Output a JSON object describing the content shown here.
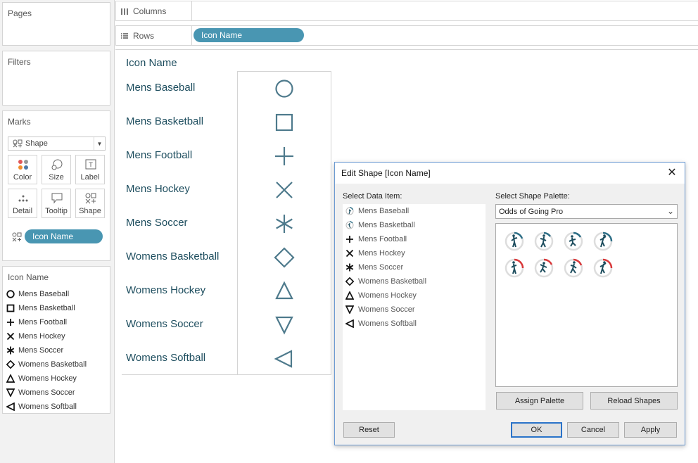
{
  "left": {
    "pages_title": "Pages",
    "filters_title": "Filters",
    "marks_title": "Marks",
    "mark_type": "Shape",
    "mark_buttons": {
      "color": "Color",
      "size": "Size",
      "label": "Label",
      "detail": "Detail",
      "tooltip": "Tooltip",
      "shape": "Shape"
    },
    "shape_pill": "Icon Name",
    "legend": {
      "title": "Icon Name",
      "items": [
        "Mens Baseball",
        "Mens Basketball",
        "Mens Football",
        "Mens Hockey",
        "Mens Soccer",
        "Womens Basketball",
        "Womens Hockey",
        "Womens Soccer",
        "Womens Softball"
      ]
    }
  },
  "shelves": {
    "columns_label": "Columns",
    "rows_label": "Rows",
    "rows_pill": "Icon Name"
  },
  "view": {
    "header": "Icon Name",
    "rows": [
      {
        "label": "Mens Baseball",
        "shape": "circle-icon"
      },
      {
        "label": "Mens Basketball",
        "shape": "square-icon"
      },
      {
        "label": "Mens Football",
        "shape": "plus-icon"
      },
      {
        "label": "Mens Hockey",
        "shape": "x-icon"
      },
      {
        "label": "Mens Soccer",
        "shape": "asterisk-icon"
      },
      {
        "label": "Womens Basketball",
        "shape": "diamond-icon"
      },
      {
        "label": "Womens Hockey",
        "shape": "triangle-up-icon"
      },
      {
        "label": "Womens Soccer",
        "shape": "triangle-down-icon"
      },
      {
        "label": "Womens Softball",
        "shape": "triangle-left-icon"
      }
    ],
    "shape_color": "#4e7a8c"
  },
  "dialog": {
    "title": "Edit Shape [Icon Name]",
    "select_item_label": "Select Data Item:",
    "select_palette_label": "Select Shape Palette:",
    "palette_value": "Odds of Going Pro",
    "items": [
      {
        "label": "Mens Baseball",
        "icon": "player-icon"
      },
      {
        "label": "Mens Basketball",
        "icon": "player-icon"
      },
      {
        "label": "Mens Football",
        "icon": "plus-icon"
      },
      {
        "label": "Mens Hockey",
        "icon": "x-icon"
      },
      {
        "label": "Mens Soccer",
        "icon": "asterisk-icon"
      },
      {
        "label": "Womens Basketball",
        "icon": "diamond-icon"
      },
      {
        "label": "Womens Hockey",
        "icon": "triangle-up-icon"
      },
      {
        "label": "Womens Soccer",
        "icon": "triangle-down-icon"
      },
      {
        "label": "Womens Softball",
        "icon": "triangle-left-icon"
      }
    ],
    "assign_palette": "Assign Palette",
    "reload_shapes": "Reload Shapes",
    "reset": "Reset",
    "ok": "OK",
    "cancel": "Cancel",
    "apply": "Apply",
    "accent_teal": "#2c6e86",
    "accent_red": "#d9383a"
  }
}
